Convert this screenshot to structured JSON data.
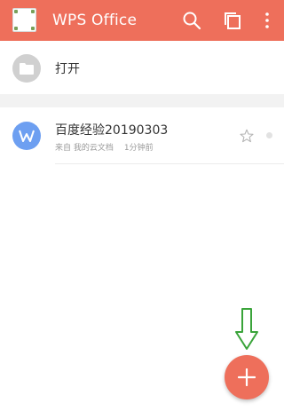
{
  "colors": {
    "accent": "#ee6f5b",
    "file_icon": "#6d9ff1",
    "annotation": "#3aa43a"
  },
  "appbar": {
    "title": "WPS Office",
    "icons": [
      "search-icon",
      "windows-icon",
      "more-vert-icon"
    ]
  },
  "open_item": {
    "label": "打开",
    "icon": "folder-icon"
  },
  "recent": [
    {
      "name": "百度经验20190303",
      "source": "来自 我的云文档",
      "time": "1分钟前",
      "icon": "wps-writer-icon",
      "starred": false
    }
  ],
  "fab": {
    "icon": "plus-icon"
  }
}
